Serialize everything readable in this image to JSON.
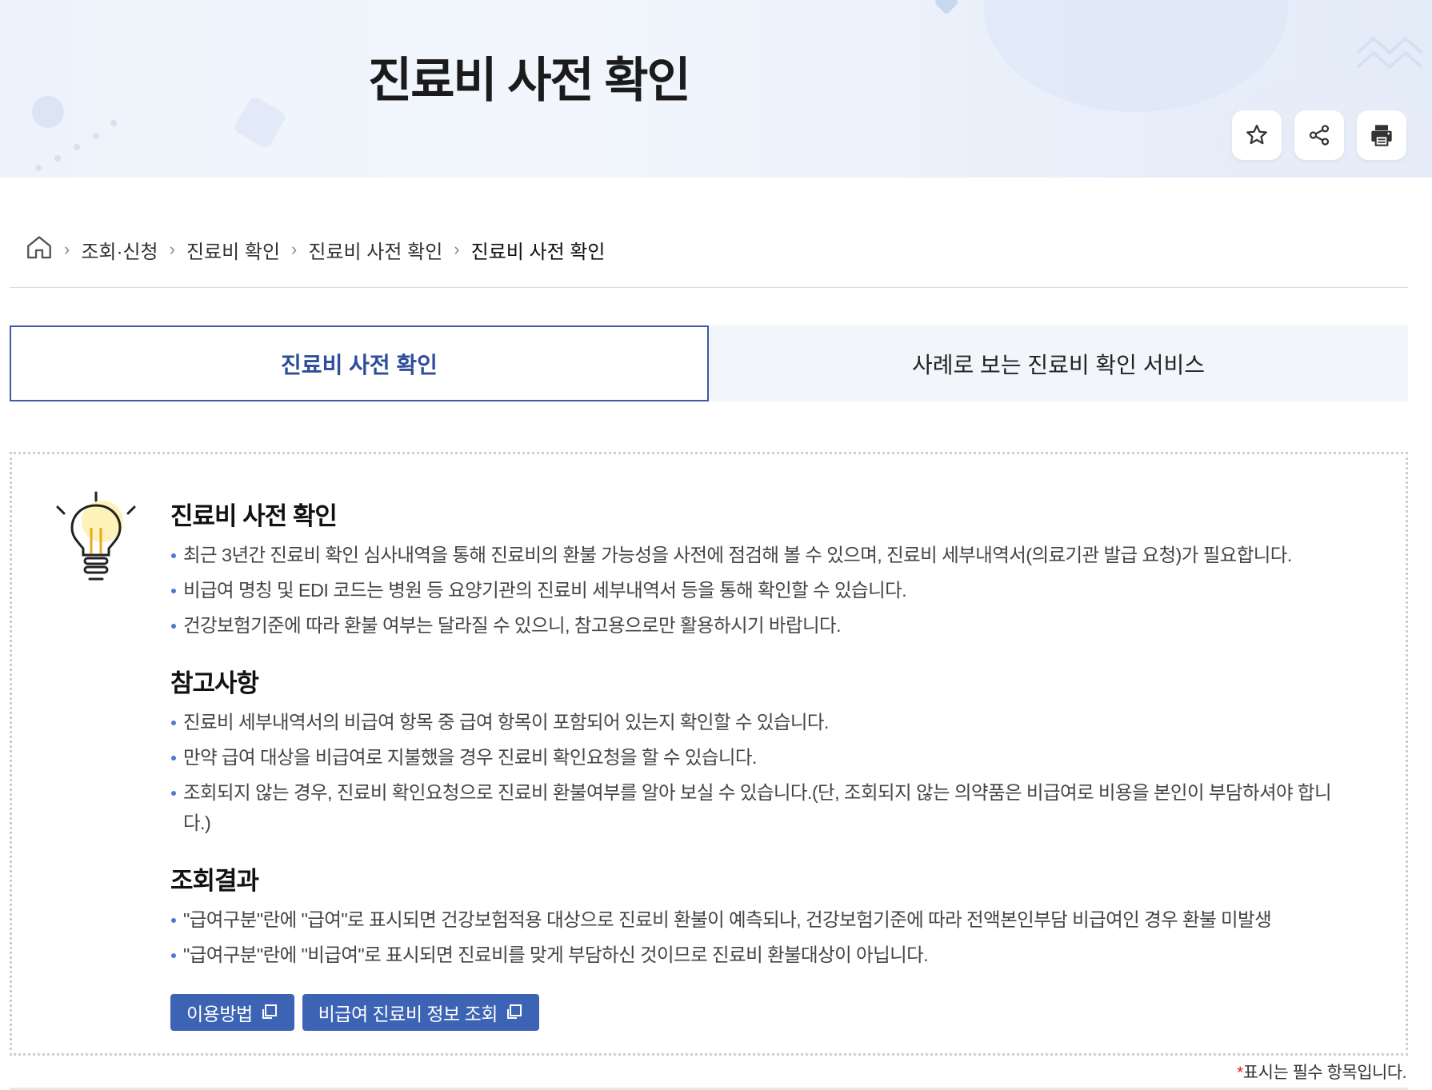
{
  "header": {
    "title": "진료비 사전 확인",
    "tools": [
      {
        "name": "favorite",
        "icon": "star-icon"
      },
      {
        "name": "share",
        "icon": "share-icon"
      },
      {
        "name": "print",
        "icon": "printer-icon"
      }
    ]
  },
  "breadcrumb": {
    "home_icon": "home-icon",
    "items": [
      "조회·신청",
      "진료비 확인",
      "진료비 사전 확인",
      "진료비 사전 확인"
    ]
  },
  "tabs": [
    {
      "label": "진료비 사전 확인",
      "active": true
    },
    {
      "label": "사례로 보는 진료비 확인 서비스",
      "active": false
    }
  ],
  "info": {
    "icon": "lightbulb-icon",
    "sections": [
      {
        "title": "진료비 사전 확인",
        "items": [
          "최근 3년간 진료비 확인 심사내역을 통해 진료비의 환불 가능성을 사전에 점검해 볼 수 있으며, 진료비 세부내역서(의료기관 발급 요청)가 필요합니다.",
          "비급여 명칭 및 EDI 코드는 병원 등 요양기관의 진료비 세부내역서 등을 통해 확인할 수 있습니다.",
          "건강보험기준에 따라 환불 여부는 달라질 수 있으니, 참고용으로만 활용하시기 바랍니다."
        ]
      },
      {
        "title": "참고사항",
        "items": [
          "진료비 세부내역서의 비급여 항목 중 급여 항목이 포함되어 있는지 확인할 수 있습니다.",
          "만약 급여 대상을 비급여로 지불했을 경우 진료비 확인요청을 할 수 있습니다.",
          "조회되지 않는 경우, 진료비 확인요청으로 진료비 환불여부를 알아 보실 수 있습니다.(단, 조회되지 않는 의약품은 비급여로 비용을 본인이 부담하셔야 합니다.)"
        ]
      },
      {
        "title": "조회결과",
        "items": [
          "\"급여구분\"란에 \"급여\"로 표시되면 건강보험적용 대상으로 진료비 환불이 예측되나, 건강보험기준에 따라 전액본인부담 비급여인 경우 환불 미발생",
          "\"급여구분\"란에 \"비급여\"로 표시되면 진료비를 맞게 부담하신 것이므로 진료비 환불대상이 아닙니다."
        ]
      }
    ],
    "buttons": [
      {
        "label": "이용방법",
        "icon": "new-window-icon"
      },
      {
        "label": "비급여 진료비 정보 조회",
        "icon": "new-window-icon"
      }
    ]
  },
  "required_note": {
    "star": "*",
    "text": "표시는 필수 항목입니다."
  },
  "colors": {
    "accent": "#3d63b5",
    "tab_border": "#3c5aa6",
    "bullet": "#4a7bd0",
    "required": "#dd2222"
  }
}
